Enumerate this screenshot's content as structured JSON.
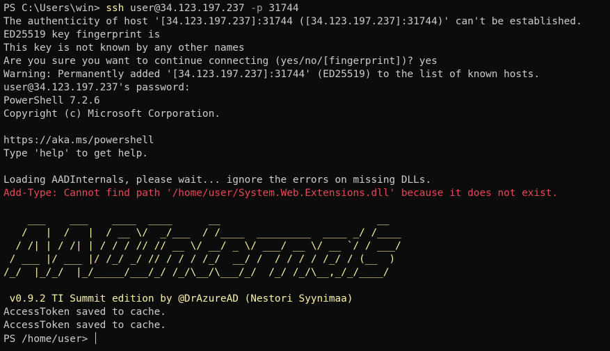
{
  "terminal": {
    "cmd": {
      "prompt": "PS C:\\Users\\win> ",
      "command": "ssh",
      "arg_user": " user@34.123.197.237 ",
      "flag": "-p",
      "port": " 31744"
    },
    "lines_pre": [
      "The authenticity of host '[34.123.197.237]:31744 ([34.123.197.237]:31744)' can't be established.",
      "ED25519 key fingerprint is",
      "This key is not known by any other names",
      "Are you sure you want to continue connecting (yes/no/[fingerprint])? yes",
      "Warning: Permanently added '[34.123.197.237]:31744' (ED25519) to the list of known hosts.",
      "user@34.123.197.237's password:",
      "PowerShell 7.2.6",
      "Copyright (c) Microsoft Corporation.",
      "",
      "https://aka.ms/powershell",
      "Type 'help' to get help.",
      "",
      "Loading AADInternals, please wait... ignore the errors on missing DLLs."
    ],
    "error_line": "Add-Type: Cannot find path '/home/user/System.Web.Extensions.dll' because it does not exist.",
    "banner": [
      "",
      "    ___    ___    ____  ____      __                          __",
      "   /   |  /   |  / __ \\/  _/___  / /____  _________  ____ _/ /____",
      "  / /| | / /| | / / / // // __ \\/ __/ _ \\/ ___/ __ \\/ __ `/ / ___/",
      " / ___ |/ ___ |/ /_/ _/ // / / / /_/  __/ /  / / / / /_/ / (__  )",
      "/_/  |_/_/  |_/_____/___/_/ /_/\\__/\\___/_/  /_/ /_/\\__,_/_/____/",
      "",
      " v0.9.2 TI Summit edition by @DrAzureAD (Nestori Syynimaa)"
    ],
    "lines_post": [
      "AccessToken saved to cache.",
      "AccessToken saved to cache."
    ],
    "final_prompt": "PS /home/user> "
  },
  "colors": {
    "background": "#0c0c0c",
    "foreground": "#cccccc",
    "command": "#f9f1a5",
    "error": "#e74856",
    "flag": "#9d9d9d"
  }
}
